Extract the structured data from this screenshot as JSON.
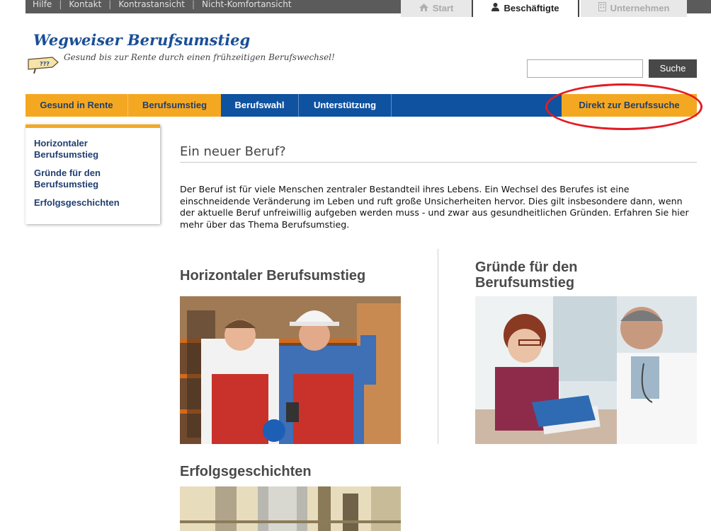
{
  "utility_links": [
    "Hilfe",
    "Kontakt",
    "Kontrastansicht",
    "Nicht-Komfortansicht"
  ],
  "top_tabs": {
    "start": "Start",
    "beschaeftigte": "Beschäftigte",
    "unternehmen": "Unternehmen"
  },
  "logo": {
    "title": "Wegweiser Berufsumstieg",
    "subtitle": "Gesund bis zur Rente durch einen frühzeitigen Berufswechsel!",
    "sign_text": "???"
  },
  "search": {
    "value": "",
    "button_label": "Suche"
  },
  "nav": {
    "items": [
      "Gesund in Rente",
      "Berufsumstieg",
      "Berufswahl",
      "Unterstützung"
    ],
    "cta": "Direkt zur Berufssuche"
  },
  "sidebar": {
    "items": [
      "Horizontaler Berufsumstieg",
      "Gründe für den Berufsumstieg",
      "Erfolgsgeschichten"
    ]
  },
  "main": {
    "title": "Ein neuer Beruf?",
    "intro": "Der Beruf ist für viele Menschen zentraler Bestandteil ihres Lebens. Ein Wechsel des Berufes ist eine einschneidende Veränderung im Leben und ruft große Unsicherheiten hervor. Dies gilt insbesondere dann, wenn der aktuelle Beruf unfreiwillig aufgeben werden muss - und zwar aus gesundheitlichen Gründen. Erfahren Sie hier mehr über das Thema Berufsumstieg.",
    "teasers": [
      "Horizontaler Berufsumstieg",
      "Gründe für den Berufsumstieg",
      "Erfolgsgeschichten"
    ]
  },
  "colors": {
    "nav_blue": "#0f52a0",
    "accent_orange": "#f4a822",
    "annotation_red": "#e31b23",
    "logo_blue": "#1a4f97"
  }
}
